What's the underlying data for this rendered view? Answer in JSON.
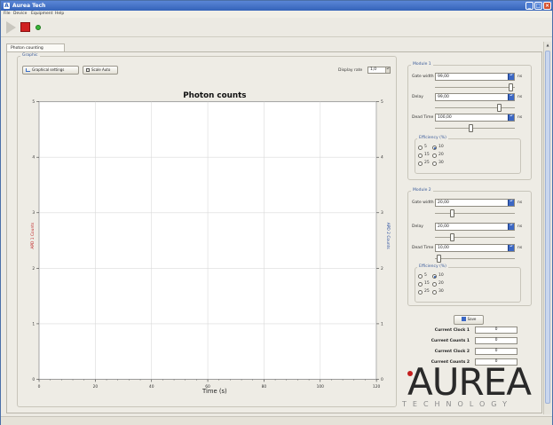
{
  "window": {
    "title": "Aurea Tech"
  },
  "menu": [
    "File",
    "Device",
    "Equipment",
    "Help"
  ],
  "toolbar": {
    "play_icon": "play-icon",
    "stop_icon": "stop-icon",
    "status_icon": "status-dot-icon"
  },
  "tabs": [
    "Photon counting"
  ],
  "graphic": {
    "legend": "Graphic",
    "graphical_settings_label": "Graphical settings",
    "scale_auto_label": "Scale Auto",
    "display_rate_label": "Display rate",
    "display_rate_value": "1,0"
  },
  "chart_data": {
    "type": "line",
    "title": "Photon counts",
    "xlabel": "Time (s)",
    "ylabel_left": "APD 1 Counts",
    "ylabel_right": "APD 2 Counts",
    "xlim": [
      0,
      120
    ],
    "ylim": [
      0,
      5
    ],
    "x_ticks": [
      "0",
      "20",
      "40",
      "60",
      "80",
      "100",
      "120"
    ],
    "y_ticks": [
      "0",
      "1",
      "2",
      "3",
      "4",
      "5"
    ],
    "grid": true,
    "series": []
  },
  "module1": {
    "legend": "Module 1",
    "gate_width_label": "Gate width",
    "gate_width_value": "99,00",
    "gate_width_unit": "ns",
    "gate_width_level": 0.98,
    "delay_label": "Delay",
    "delay_value": "99,00",
    "delay_unit": "ns",
    "delay_level": 0.82,
    "dead_time_label": "Dead Time",
    "dead_time_value": "100,00",
    "dead_time_unit": "ns",
    "dead_time_level": 0.45,
    "efficiency_legend": "Efficiency (%)",
    "efficiency_options": [
      "5",
      "10",
      "15",
      "20",
      "25",
      "30"
    ],
    "efficiency_selected": "10"
  },
  "module2": {
    "legend": "Module 2",
    "gate_width_label": "Gate width",
    "gate_width_value": "20,00",
    "gate_width_unit": "ns",
    "gate_width_level": 0.2,
    "delay_label": "Delay",
    "delay_value": "20,00",
    "delay_unit": "ns",
    "delay_level": 0.2,
    "dead_time_label": "Dead Time",
    "dead_time_value": "10,00",
    "dead_time_unit": "ns",
    "dead_time_level": 0.02,
    "efficiency_legend": "Efficiency (%)",
    "efficiency_options": [
      "5",
      "10",
      "15",
      "20",
      "25",
      "30"
    ],
    "efficiency_selected": "10"
  },
  "save_label": "Save",
  "counters": [
    {
      "label": "Current Clock 1",
      "value": "0"
    },
    {
      "label": "Current Counts 1",
      "value": "0"
    },
    {
      "label": "Current Clock 2",
      "value": "0"
    },
    {
      "label": "Current Counts 2",
      "value": "0"
    }
  ],
  "logo": {
    "word": "AUREA",
    "sub": "TECHNOLOGY"
  },
  "colors": {
    "accent": "#3b67c4",
    "left_axis": "#c0282a",
    "right_axis": "#2a4fa0"
  }
}
